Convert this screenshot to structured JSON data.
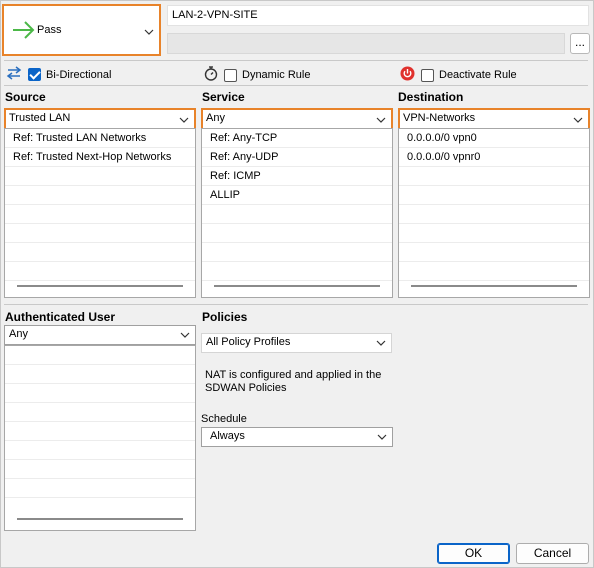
{
  "action": {
    "value": "Pass",
    "arrow_color": "#4cb848"
  },
  "rule_name": {
    "value": "LAN-2-VPN-SITE"
  },
  "comment": {
    "value": ""
  },
  "more_button": "...",
  "options": {
    "bidirectional": {
      "label": "Bi-Directional",
      "checked": true
    },
    "dynamic_rule": {
      "label": "Dynamic Rule",
      "checked": false
    },
    "deactivate_rule": {
      "label": "Deactivate Rule",
      "checked": false
    }
  },
  "source": {
    "title": "Source",
    "selected": "Trusted LAN",
    "items": [
      "Ref: Trusted LAN Networks",
      "Ref: Trusted Next-Hop Networks"
    ]
  },
  "service": {
    "title": "Service",
    "selected": "Any",
    "items": [
      "Ref: Any-TCP",
      "Ref: Any-UDP",
      "Ref: ICMP",
      "ALLIP"
    ]
  },
  "destination": {
    "title": "Destination",
    "selected": "VPN-Networks",
    "items": [
      "0.0.0.0/0 vpn0",
      "0.0.0.0/0 vpnr0"
    ]
  },
  "auth_user": {
    "title": "Authenticated User",
    "selected": "Any"
  },
  "policies": {
    "title": "Policies",
    "profile": "All Policy Profiles",
    "nat_note": "NAT is configured and applied in the SDWAN Policies",
    "schedule_label": "Schedule",
    "schedule": "Always"
  },
  "buttons": {
    "ok": "OK",
    "cancel": "Cancel"
  },
  "colors": {
    "accent_orange": "#e8832a",
    "check_blue": "#0a64c8",
    "power_red": "#e0312d"
  }
}
